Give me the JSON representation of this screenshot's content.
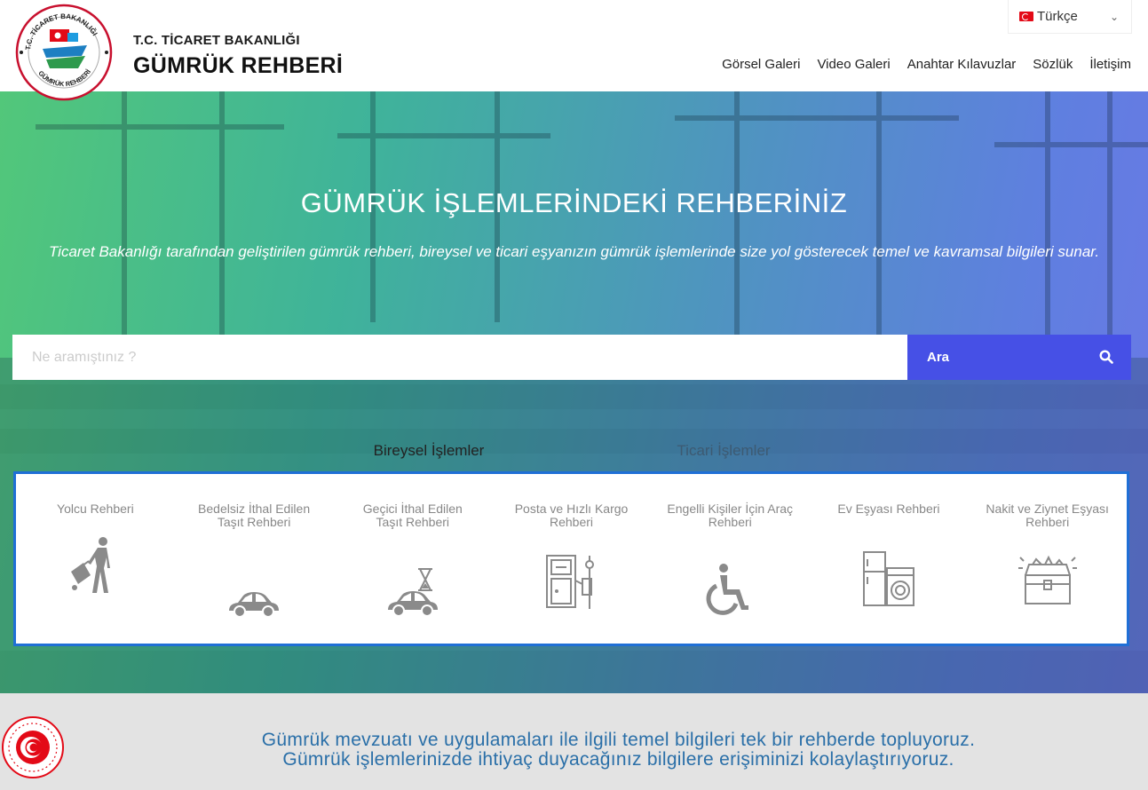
{
  "header": {
    "logo_top_text": "T.C. TİCARET BAKANLIĞI",
    "logo_bottom_text": "GÜMRÜK REHBERİ",
    "subtitle": "T.C. TİCARET BAKANLIĞI",
    "title": "GÜMRÜK REHBERİ",
    "language": "Türkçe",
    "nav": [
      "Görsel Galeri",
      "Video Galeri",
      "Anahtar Kılavuzlar",
      "Sözlük",
      "İletişim"
    ]
  },
  "hero": {
    "title": "GÜMRÜK İŞLEMLERİNDEKİ REHBERİNİZ",
    "description": "Ticaret Bakanlığı tarafından geliştirilen gümrük rehberi, bireysel ve ticari eşyanızın gümrük işlemlerinde size yol gösterecek temel ve kavramsal bilgileri sunar."
  },
  "search": {
    "placeholder": "Ne aramıştınız ?",
    "button_label": "Ara"
  },
  "tabs": [
    {
      "label": "Bireysel İşlemler",
      "active": true
    },
    {
      "label": "Ticari İşlemler",
      "active": false
    }
  ],
  "cards": [
    {
      "label": "Yolcu Rehberi",
      "icon": "traveler-icon"
    },
    {
      "label": "Bedelsiz İthal Edilen Taşıt Rehberi",
      "icon": "car-icon"
    },
    {
      "label": "Geçici İthal Edilen Taşıt Rehberi",
      "icon": "car-hourglass-icon"
    },
    {
      "label": "Posta ve Hızlı Kargo Rehberi",
      "icon": "mailbox-icon"
    },
    {
      "label": "Engelli Kişiler İçin Araç Rehberi",
      "icon": "wheelchair-icon"
    },
    {
      "label": "Ev Eşyası Rehberi",
      "icon": "appliances-icon"
    },
    {
      "label": "Nakit ve Ziynet Eşyası Rehberi",
      "icon": "treasure-chest-icon"
    }
  ],
  "band": {
    "line1": "Gümrük mevzuatı ve uygulamaları ile ilgili temel bilgileri tek bir rehberde topluyoruz.",
    "line2": "Gümrük işlemlerinizde ihtiyaç duyacağınız bilgilere erişiminizi kolaylaştırıyoruz."
  },
  "colors": {
    "accent": "#4650e6",
    "panel_border": "#1f6fd6",
    "band_text": "#2a6fa8",
    "band_bg": "#e3e3e3"
  }
}
